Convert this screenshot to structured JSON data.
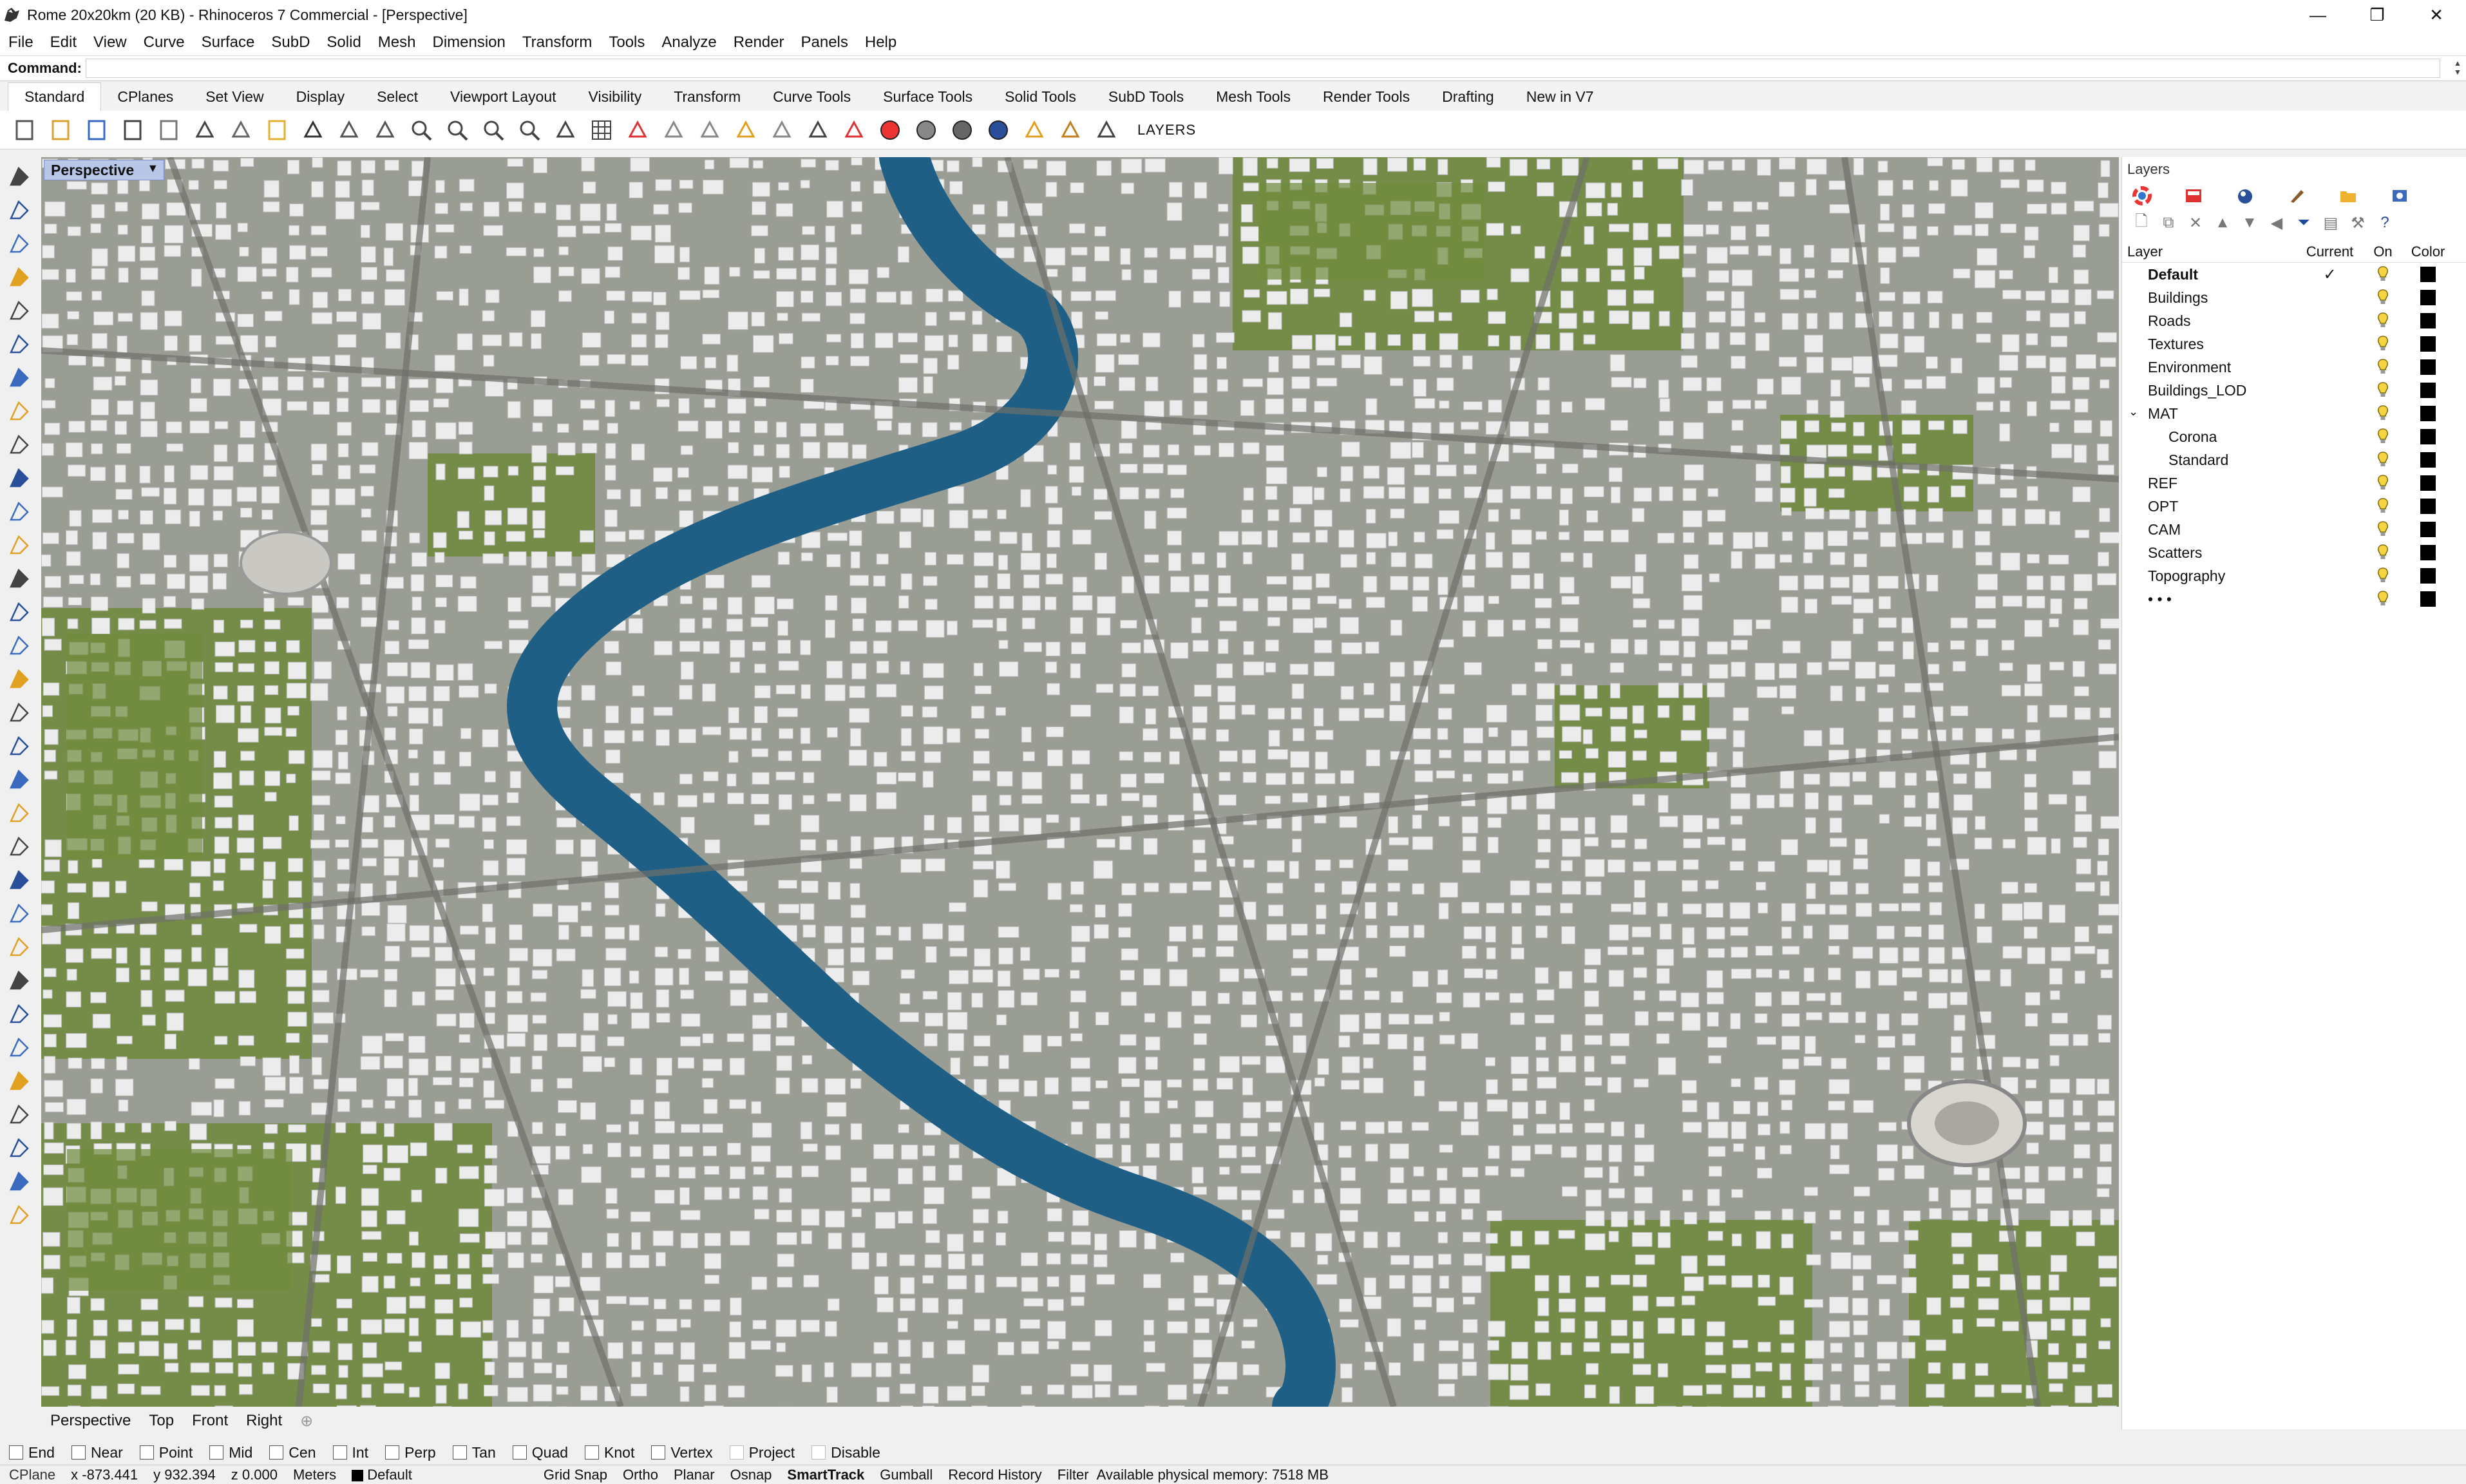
{
  "window": {
    "title": "Rome 20x20km (20 KB) - Rhinoceros 7 Commercial - [Perspective]",
    "min": "—",
    "max": "❐",
    "close": "✕"
  },
  "menu": [
    "File",
    "Edit",
    "View",
    "Curve",
    "Surface",
    "SubD",
    "Solid",
    "Mesh",
    "Dimension",
    "Transform",
    "Tools",
    "Analyze",
    "Render",
    "Panels",
    "Help"
  ],
  "command": {
    "label": "Command:",
    "value": ""
  },
  "toolbar_tabs": [
    "Standard",
    "CPlanes",
    "Set View",
    "Display",
    "Select",
    "Viewport Layout",
    "Visibility",
    "Transform",
    "Curve Tools",
    "Surface Tools",
    "Solid Tools",
    "SubD Tools",
    "Mesh Tools",
    "Render Tools",
    "Drafting",
    "New in V7"
  ],
  "toolbar": {
    "layers_label": "LAYERS",
    "icons": [
      "new-icon",
      "open-icon",
      "save-icon",
      "print-icon",
      "import-icon",
      "cut-icon",
      "copy-icon",
      "paste-icon",
      "undo-icon",
      "pan-icon",
      "move-icon",
      "zoom-icon",
      "zoom-window-icon",
      "zoom-extents-icon",
      "zoom-selected-icon",
      "rotate-view-icon",
      "grid-icon",
      "car-icon",
      "shade-icon",
      "ruler-icon",
      "snap-icon",
      "bulb-icon",
      "lock-icon",
      "layer-icon",
      "color-wheel-icon",
      "sphere-icon",
      "sphere-shaded-icon",
      "sphere-blue-icon",
      "pin-icon",
      "gear-icon",
      "select-icon"
    ]
  },
  "viewport": {
    "label": "Perspective",
    "tabs": [
      "Perspective",
      "Top",
      "Front",
      "Right"
    ],
    "add_tab": "⊕"
  },
  "layers_panel": {
    "title": "Layers",
    "columns": {
      "layer": "Layer",
      "current": "Current",
      "on": "On",
      "color": "Color"
    },
    "current_mark": "✓",
    "layers": [
      {
        "name": "Default",
        "current": true,
        "bold": true
      },
      {
        "name": "Buildings"
      },
      {
        "name": "Roads"
      },
      {
        "name": "Textures"
      },
      {
        "name": "Environment"
      },
      {
        "name": "Buildings_LOD"
      },
      {
        "name": "MAT",
        "expanded": true
      },
      {
        "name": "Corona",
        "sub": true
      },
      {
        "name": "Standard",
        "sub": true
      },
      {
        "name": "REF"
      },
      {
        "name": "OPT"
      },
      {
        "name": "CAM"
      },
      {
        "name": "Scatters"
      },
      {
        "name": "Topography"
      },
      {
        "name": "• • •"
      }
    ]
  },
  "osnaps": [
    {
      "label": "End",
      "enabled": true
    },
    {
      "label": "Near",
      "enabled": true
    },
    {
      "label": "Point",
      "enabled": true
    },
    {
      "label": "Mid",
      "enabled": true
    },
    {
      "label": "Cen",
      "enabled": true
    },
    {
      "label": "Int",
      "enabled": true
    },
    {
      "label": "Perp",
      "enabled": true
    },
    {
      "label": "Tan",
      "enabled": true
    },
    {
      "label": "Quad",
      "enabled": true
    },
    {
      "label": "Knot",
      "enabled": true
    },
    {
      "label": "Vertex",
      "enabled": true
    },
    {
      "label": "Project",
      "enabled": false
    },
    {
      "label": "Disable",
      "enabled": false
    }
  ],
  "status": {
    "cplane": "CPlane",
    "x": "x -873.441",
    "y": "y 932.394",
    "z": "z 0.000",
    "units": "Meters",
    "layer": "Default",
    "grid_snap": "Grid Snap",
    "ortho": "Ortho",
    "planar": "Planar",
    "osnap": "Osnap",
    "smarttrack": "SmartTrack",
    "gumball": "Gumball",
    "record_history": "Record History",
    "filter": "Filter",
    "memory": "Available physical memory: 7518 MB"
  },
  "colors": {
    "river": "#1f5f86",
    "ground": "#9a9d94",
    "grass": "#6f8a3c",
    "building": "#ececec",
    "viewport_label": "#b8c7e8"
  }
}
